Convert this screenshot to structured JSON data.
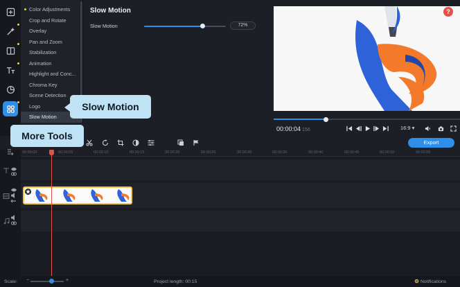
{
  "menu": {
    "items": [
      {
        "label": "Color Adjustments",
        "bullet": true
      },
      {
        "label": "Crop and Rotate",
        "bullet": false
      },
      {
        "label": "Overlay",
        "bullet": false
      },
      {
        "label": "Pan and Zoom",
        "bullet": false
      },
      {
        "label": "Stabilization",
        "bullet": false
      },
      {
        "label": "Animation",
        "bullet": false
      },
      {
        "label": "Highlight and Conc...",
        "bullet": false
      },
      {
        "label": "Chroma Key",
        "bullet": false
      },
      {
        "label": "Scene Detection",
        "bullet": false
      },
      {
        "label": "Logo",
        "bullet": false
      },
      {
        "label": "Slow Motion",
        "bullet": false
      }
    ]
  },
  "panel": {
    "title": "Slow Motion",
    "slider_label": "Slow Motion",
    "slider_value_text": "72%",
    "slider_value": 0.72
  },
  "preview": {
    "help": "?",
    "timecode": "00:00:04",
    "timecode_ms": "156",
    "progress": 0.28,
    "aspect": "16:9 ▾"
  },
  "toolbar": {
    "export_label": "Export"
  },
  "ruler": {
    "ticks": [
      "00:00:00",
      "00:00:05",
      "00:00:10",
      "00:00:15",
      "00:00:20",
      "00:00:25",
      "00:00:30",
      "00:00:35",
      "00:00:40",
      "00:00:45",
      "00:00:50",
      "00:00:55"
    ]
  },
  "callouts": {
    "slow_motion": "Slow Motion",
    "more_tools": "More Tools"
  },
  "status": {
    "scale_label": "Scale:",
    "project_length": "Project length:  00:15",
    "notifications": "Notifications"
  },
  "colors": {
    "accent": "#2f8ee8",
    "playhead": "#e0524a",
    "clip_border": "#f2c744",
    "callout": "#bfe3f4"
  }
}
